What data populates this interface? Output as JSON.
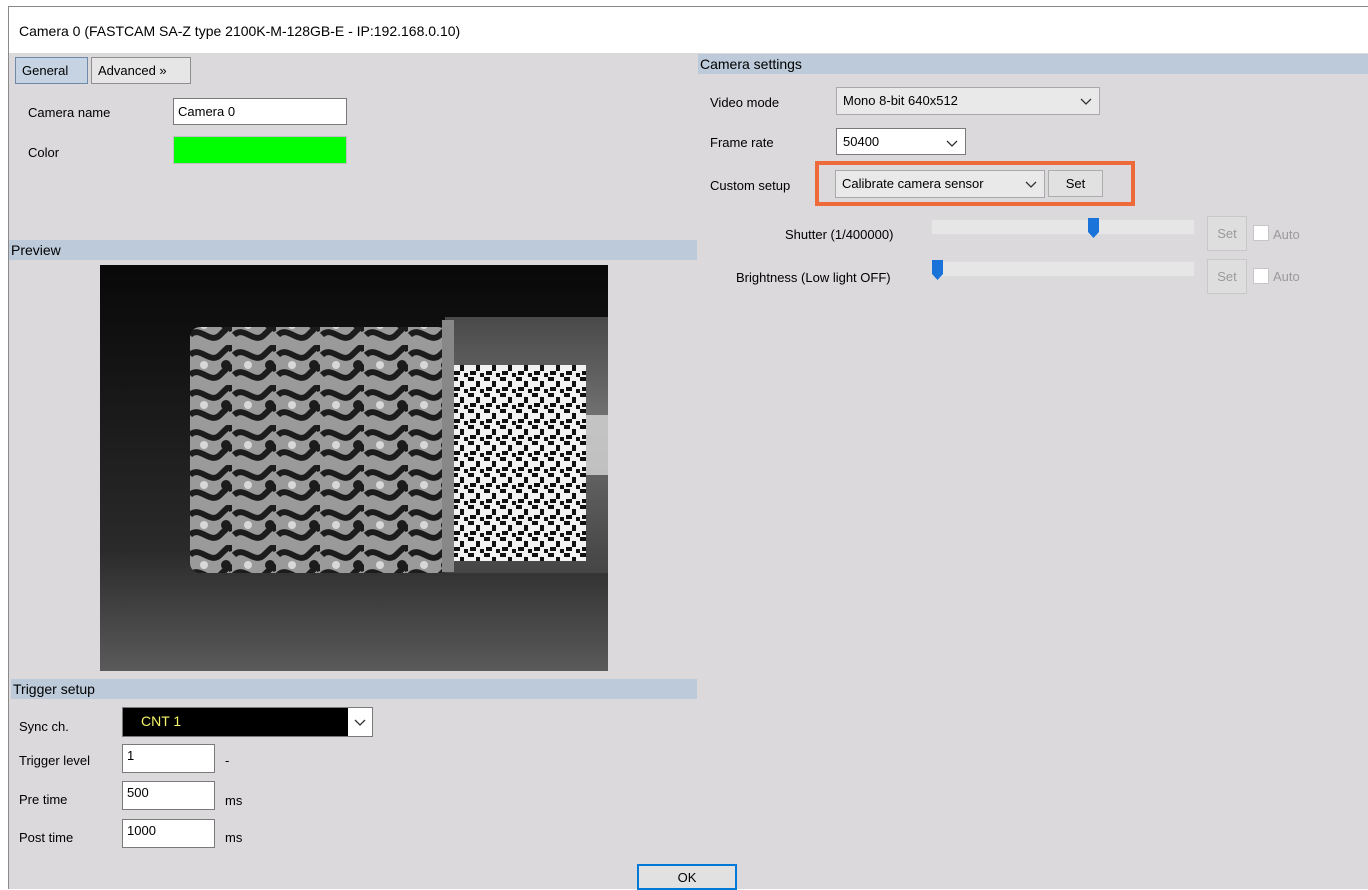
{
  "window": {
    "title": "Camera 0 (FASTCAM SA-Z type 2100K-M-128GB-E - IP:192.168.0.10)"
  },
  "tabs": {
    "general": "General",
    "advanced": "Advanced »"
  },
  "general": {
    "camera_name_label": "Camera name",
    "camera_name_value": "Camera 0",
    "color_label": "Color",
    "color_value": "#00ff00"
  },
  "preview": {
    "header": "Preview"
  },
  "camera_settings": {
    "header": "Camera settings",
    "video_mode_label": "Video mode",
    "video_mode_value": "Mono 8-bit 640x512",
    "frame_rate_label": "Frame rate",
    "frame_rate_value": "50400",
    "custom_setup_label": "Custom setup",
    "custom_setup_value": "Calibrate camera sensor",
    "custom_setup_set": "Set",
    "shutter_label": "Shutter (1/400000)",
    "shutter_level": 0.62,
    "shutter_set": "Set",
    "shutter_auto": "Auto",
    "brightness_label": "Brightness (Low light OFF)",
    "brightness_level": 0.0,
    "brightness_set": "Set",
    "brightness_auto": "Auto",
    "highlight_color": "#ef6a3a"
  },
  "trigger_setup": {
    "header": "Trigger setup",
    "sync_label": "Sync ch.",
    "sync_value": "CNT 1",
    "trigger_level_label": "Trigger level",
    "trigger_level_value": "1",
    "trigger_level_unit": "-",
    "pre_time_label": "Pre time",
    "pre_time_value": "500",
    "pre_time_unit": "ms",
    "post_time_label": "Post time",
    "post_time_value": "1000",
    "post_time_unit": "ms"
  },
  "footer": {
    "ok": "OK"
  },
  "colors": {
    "section_header": "#bccad9",
    "slider_thumb": "#1a73d9",
    "window_bg": "#dcd9dc"
  }
}
